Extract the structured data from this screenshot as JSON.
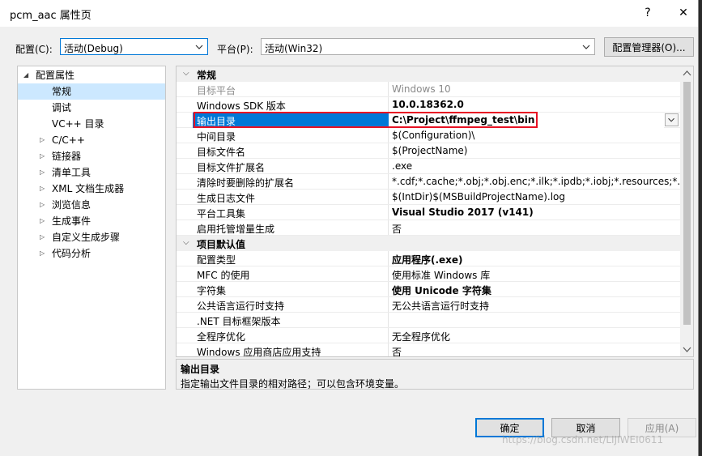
{
  "window": {
    "title": "pcm_aac 属性页",
    "help": "?",
    "close": "✕"
  },
  "toolbar": {
    "config_label": "配置(C):",
    "config_value": "活动(Debug)",
    "platform_label": "平台(P):",
    "platform_value": "活动(Win32)",
    "config_manager": "配置管理器(O)..."
  },
  "tree": {
    "root": "配置属性",
    "items": [
      {
        "label": "常规",
        "selected": true,
        "expandable": false
      },
      {
        "label": "调试",
        "expandable": false
      },
      {
        "label": "VC++ 目录",
        "expandable": false
      },
      {
        "label": "C/C++",
        "expandable": true
      },
      {
        "label": "链接器",
        "expandable": true
      },
      {
        "label": "清单工具",
        "expandable": true
      },
      {
        "label": "XML 文档生成器",
        "expandable": true
      },
      {
        "label": "浏览信息",
        "expandable": true
      },
      {
        "label": "生成事件",
        "expandable": true
      },
      {
        "label": "自定义生成步骤",
        "expandable": true
      },
      {
        "label": "代码分析",
        "expandable": true
      }
    ]
  },
  "grid": {
    "sections": [
      {
        "title": "常规",
        "rows": [
          {
            "name": "目标平台",
            "value": "Windows 10",
            "gray": true
          },
          {
            "name": "Windows SDK 版本",
            "value": "10.0.18362.0",
            "bold": true
          },
          {
            "name": "输出目录",
            "value": "C:\\Project\\ffmpeg_test\\bin",
            "bold": true,
            "selected": true
          },
          {
            "name": "中间目录",
            "value": "$(Configuration)\\"
          },
          {
            "name": "目标文件名",
            "value": "$(ProjectName)"
          },
          {
            "name": "目标文件扩展名",
            "value": ".exe"
          },
          {
            "name": "清除时要删除的扩展名",
            "value": "*.cdf;*.cache;*.obj;*.obj.enc;*.ilk;*.ipdb;*.iobj;*.resources;*.tlb;*.tli;*.t"
          },
          {
            "name": "生成日志文件",
            "value": "$(IntDir)$(MSBuildProjectName).log"
          },
          {
            "name": "平台工具集",
            "value": "Visual Studio 2017 (v141)",
            "bold": true
          },
          {
            "name": "启用托管增量生成",
            "value": "否"
          }
        ]
      },
      {
        "title": "项目默认值",
        "rows": [
          {
            "name": "配置类型",
            "value": "应用程序(.exe)",
            "bold": true
          },
          {
            "name": "MFC 的使用",
            "value": "使用标准 Windows 库"
          },
          {
            "name": "字符集",
            "value": "使用 Unicode 字符集",
            "bold": true
          },
          {
            "name": "公共语言运行时支持",
            "value": "无公共语言运行时支持"
          },
          {
            "name": ".NET 目标框架版本",
            "value": ""
          },
          {
            "name": "全程序优化",
            "value": "无全程序优化"
          },
          {
            "name": "Windows 应用商店应用支持",
            "value": "否"
          }
        ]
      }
    ]
  },
  "description": {
    "title": "输出目录",
    "text": "指定输出文件目录的相对路径；可以包含环境变量。"
  },
  "buttons": {
    "ok": "确定",
    "cancel": "取消",
    "apply": "应用(A)"
  },
  "watermark": "https://blog.csdn.net/LIJIWEI0611",
  "colors": {
    "selection": "#0078d7",
    "highlight_border": "#e81123",
    "tree_selection": "#cce8ff"
  }
}
